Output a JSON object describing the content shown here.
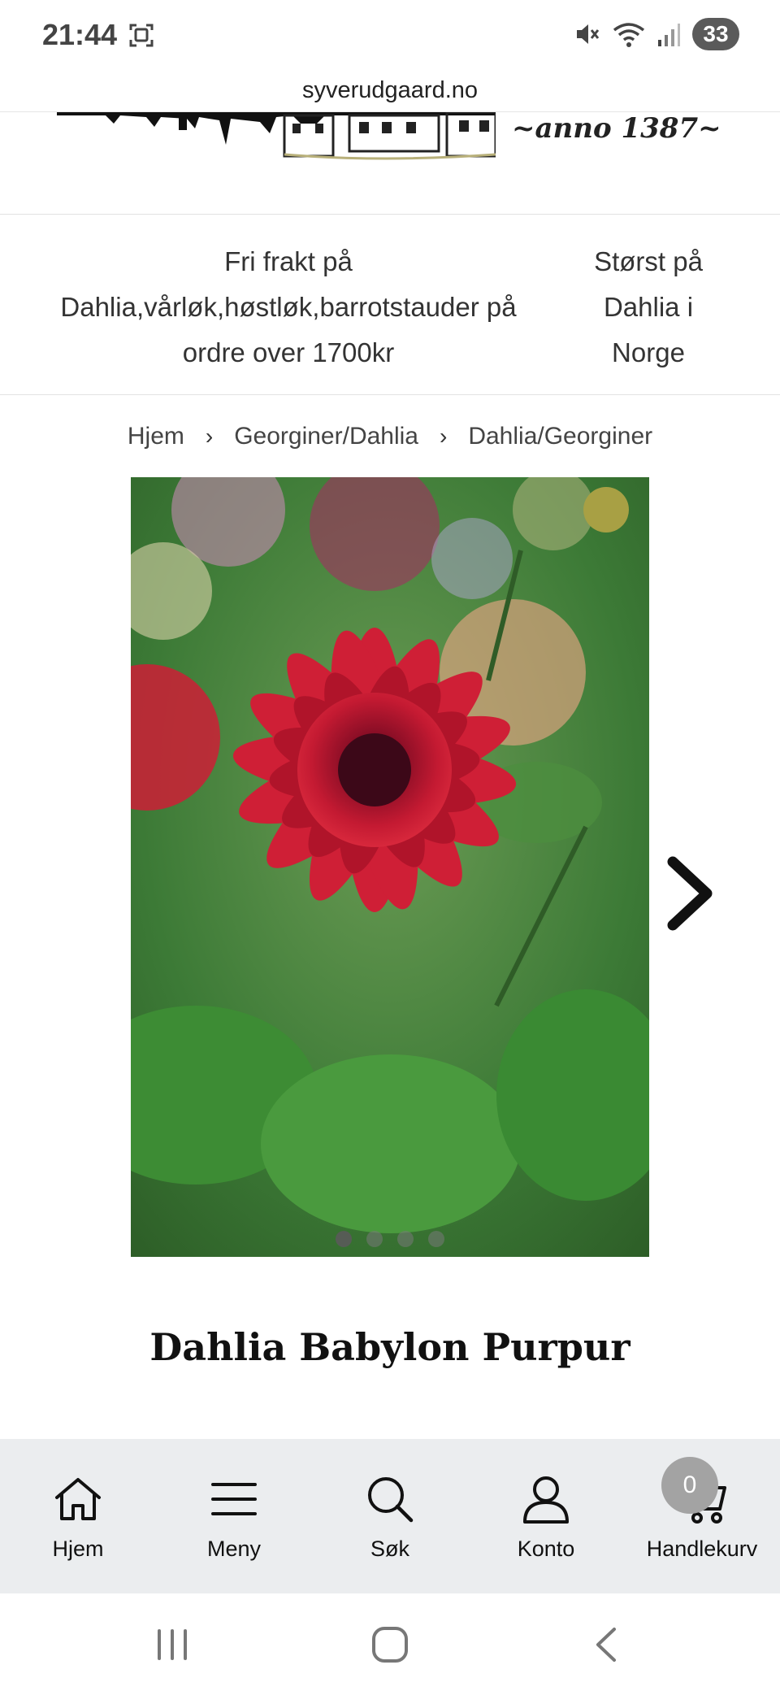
{
  "status_bar": {
    "time": "21:44",
    "battery": "33",
    "icons": [
      "screenshot-icon",
      "mute-icon",
      "wifi-icon",
      "signal-icon"
    ]
  },
  "browser": {
    "url": "syverudgaard.no"
  },
  "logo": {
    "anno_text": "~anno 1387~"
  },
  "info_band": {
    "shipping_text": "Fri frakt på Dahlia,vårløk,høstløk,barrotstauder på ordre over 1700kr",
    "largest_text": "Størst på Dahlia i Norge"
  },
  "breadcrumb": {
    "items": [
      "Hjem",
      "Georginer/Dahlia",
      "Dahlia/Georginer"
    ],
    "separator": "›"
  },
  "product": {
    "title": "Dahlia Babylon Purpur",
    "image_count": 4,
    "active_image": 1
  },
  "bottom_nav": {
    "items": [
      {
        "label": "Hjem",
        "icon": "home-icon"
      },
      {
        "label": "Meny",
        "icon": "menu-icon"
      },
      {
        "label": "Søk",
        "icon": "search-icon"
      },
      {
        "label": "Konto",
        "icon": "account-icon"
      },
      {
        "label": "Handlekurv",
        "icon": "cart-icon"
      }
    ],
    "cart_count": "0"
  },
  "colors": {
    "nav_background": "#ebedef",
    "badge": "#a3a3a3",
    "flower": "#b0142a"
  }
}
